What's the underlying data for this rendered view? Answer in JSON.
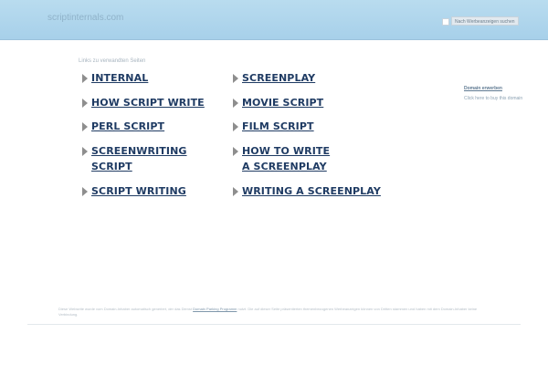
{
  "header": {
    "site_title": "scriptinternals.com",
    "search_button_label": "Nach Werbeanzeigen suchen"
  },
  "links": {
    "heading": "Links zu verwandten Seiten",
    "column1": [
      "INTERNAL",
      "HOW SCRIPT WRITE",
      "PERL SCRIPT",
      "SCREENWRITING SCRIPT",
      "SCRIPT WRITING"
    ],
    "column2": [
      "SCREENPLAY",
      "MOVIE SCRIPT",
      "FILM SCRIPT",
      "HOW TO WRITE A SCREENPLAY",
      "WRITING A SCREENPLAY"
    ]
  },
  "sidebar": {
    "domain_link": "Domain erwerben",
    "domain_subtext": "Click here to buy this domain"
  },
  "footer": {
    "text_before": "Diese Webseite wurde vom Domain-Inhaber automatisch generiert, der das Dienst",
    "link": "Domain Parking Programm",
    "text_after": "nutzt. Die auf dieser Seite präsentierten themenbezogenen Werbeanzeigen können von Dritten stammen und haben mit dem Domain-Inhaber keine Verbindung."
  },
  "colors": {
    "header_bg": "#b9dcef",
    "link": "#1f3b63"
  }
}
